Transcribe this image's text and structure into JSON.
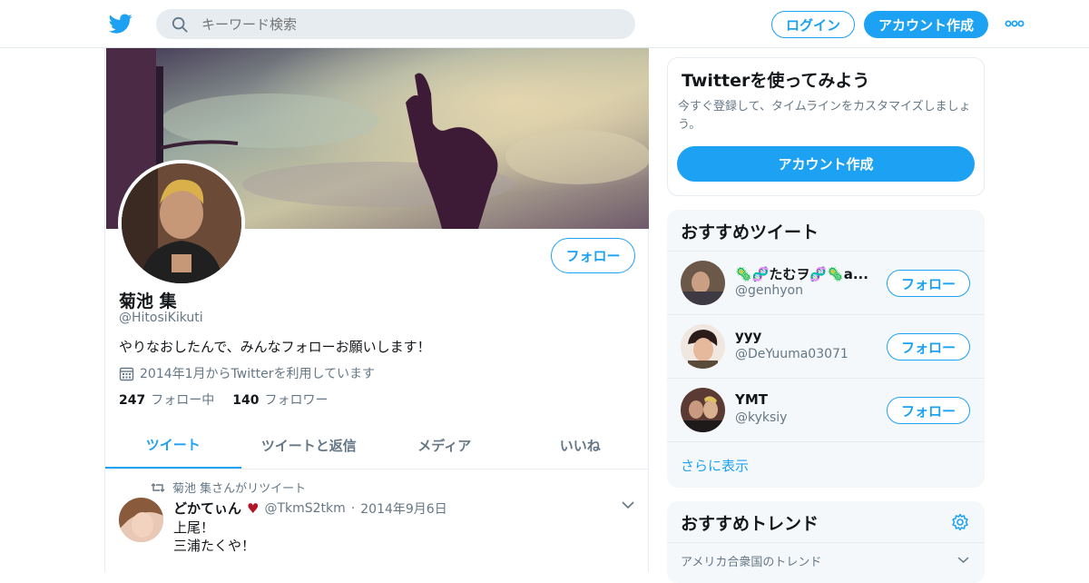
{
  "header": {
    "logo": "twitter-bird-icon",
    "search_placeholder": "キーワード検索",
    "login_label": "ログイン",
    "signup_label": "アカウント作成",
    "more": "more-dots-icon"
  },
  "profile": {
    "name": "菊池 集",
    "handle": "@HitosiKikuti",
    "bio": "やりなおしたんで、みんなフォローお願いします！",
    "joined": "2014年1月からTwitterを利用しています",
    "following_count": "247",
    "following_label": "フォロー中",
    "followers_count": "140",
    "followers_label": "フォロワー",
    "follow_label": "フォロー",
    "tabs": [
      {
        "label": "ツイート",
        "active": true
      },
      {
        "label": "ツイートと返信",
        "active": false
      },
      {
        "label": "メディア",
        "active": false
      },
      {
        "label": "いいね",
        "active": false
      }
    ]
  },
  "tweet": {
    "retweet_label": "菊池 集さんがリツイート",
    "author_name": "どかてぃん",
    "author_handle": "@TkmS2tkm",
    "date": "2014年9月6日",
    "lines": [
      "上尾！",
      "三浦たくや！"
    ]
  },
  "sidebar": {
    "signup_card": {
      "title": "Twitterを使ってみよう",
      "text": "今すぐ登録して、タイムラインをカスタマイズしましょう。",
      "button": "アカウント作成"
    },
    "recommended": {
      "title": "おすすめツイート",
      "accounts": [
        {
          "name": "🦠🧬たむヲ🧬🦠a...",
          "handle": "@genhyon",
          "button": "フォロー"
        },
        {
          "name": "yyy",
          "handle": "@DeYuuma03071",
          "button": "フォロー"
        },
        {
          "name": "YMT",
          "handle": "@kyksiy",
          "button": "フォロー"
        }
      ],
      "show_more": "さらに表示"
    },
    "trends": {
      "title": "おすすめトレンド",
      "location": "アメリカ合衆国のトレンド"
    }
  },
  "colors": {
    "accent": "#1da1f2",
    "muted": "#657786",
    "panel_bg": "#f5f8fa"
  }
}
